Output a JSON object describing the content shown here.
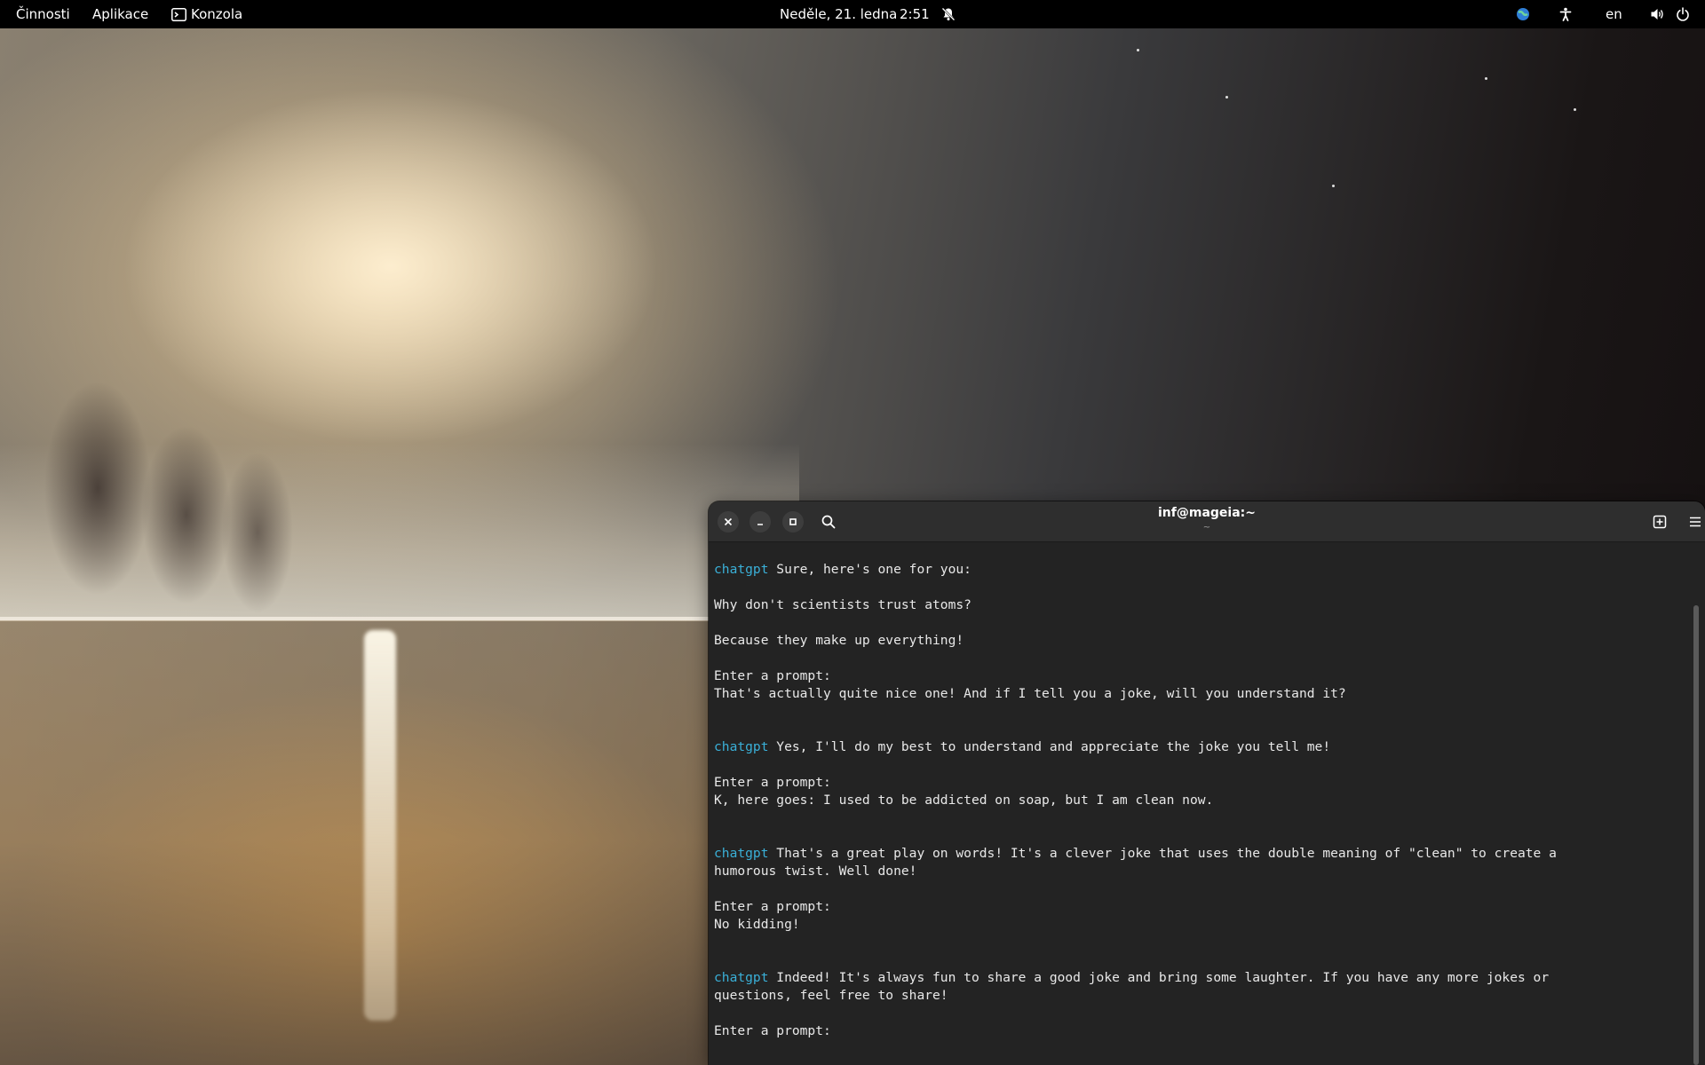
{
  "topbar": {
    "activities": "Činnosti",
    "applications": "Aplikace",
    "app_name": "Konzola",
    "date": "Neděle, 21. ledna",
    "time": "2:51",
    "language": "en",
    "icons": [
      "terminal-icon",
      "notifications-off-icon",
      "network-icon",
      "accessibility-icon",
      "volume-icon",
      "power-icon"
    ]
  },
  "terminal": {
    "title": "inf@mageia:~",
    "subtitle": "~",
    "lines": [
      {
        "prefix": "chatgpt",
        "text": " Sure, here's one for you:"
      },
      {
        "prefix": "",
        "text": ""
      },
      {
        "prefix": "",
        "text": "Why don't scientists trust atoms?"
      },
      {
        "prefix": "",
        "text": ""
      },
      {
        "prefix": "",
        "text": "Because they make up everything!"
      },
      {
        "prefix": "",
        "text": ""
      },
      {
        "prefix": "",
        "text": "Enter a prompt:"
      },
      {
        "prefix": "",
        "text": "That's actually quite nice one! And if I tell you a joke, will you understand it?"
      },
      {
        "prefix": "",
        "text": ""
      },
      {
        "prefix": "",
        "text": ""
      },
      {
        "prefix": "chatgpt",
        "text": " Yes, I'll do my best to understand and appreciate the joke you tell me!"
      },
      {
        "prefix": "",
        "text": ""
      },
      {
        "prefix": "",
        "text": "Enter a prompt:"
      },
      {
        "prefix": "",
        "text": "K, here goes: I used to be addicted on soap, but I am clean now."
      },
      {
        "prefix": "",
        "text": ""
      },
      {
        "prefix": "",
        "text": ""
      },
      {
        "prefix": "chatgpt",
        "text": " That's a great play on words! It's a clever joke that uses the double meaning of \"clean\" to create a"
      },
      {
        "prefix": "",
        "text": "humorous twist. Well done!"
      },
      {
        "prefix": "",
        "text": ""
      },
      {
        "prefix": "",
        "text": "Enter a prompt:"
      },
      {
        "prefix": "",
        "text": "No kidding!"
      },
      {
        "prefix": "",
        "text": ""
      },
      {
        "prefix": "",
        "text": ""
      },
      {
        "prefix": "chatgpt",
        "text": " Indeed! It's always fun to share a good joke and bring some laughter. If you have any more jokes or"
      },
      {
        "prefix": "",
        "text": "questions, feel free to share!"
      },
      {
        "prefix": "",
        "text": ""
      },
      {
        "prefix": "",
        "text": "Enter a prompt:"
      }
    ],
    "colors": {
      "background": "#232323",
      "header": "#2e2e2e",
      "prefix": "#3ab0d8",
      "text": "#e8e8e8"
    }
  }
}
